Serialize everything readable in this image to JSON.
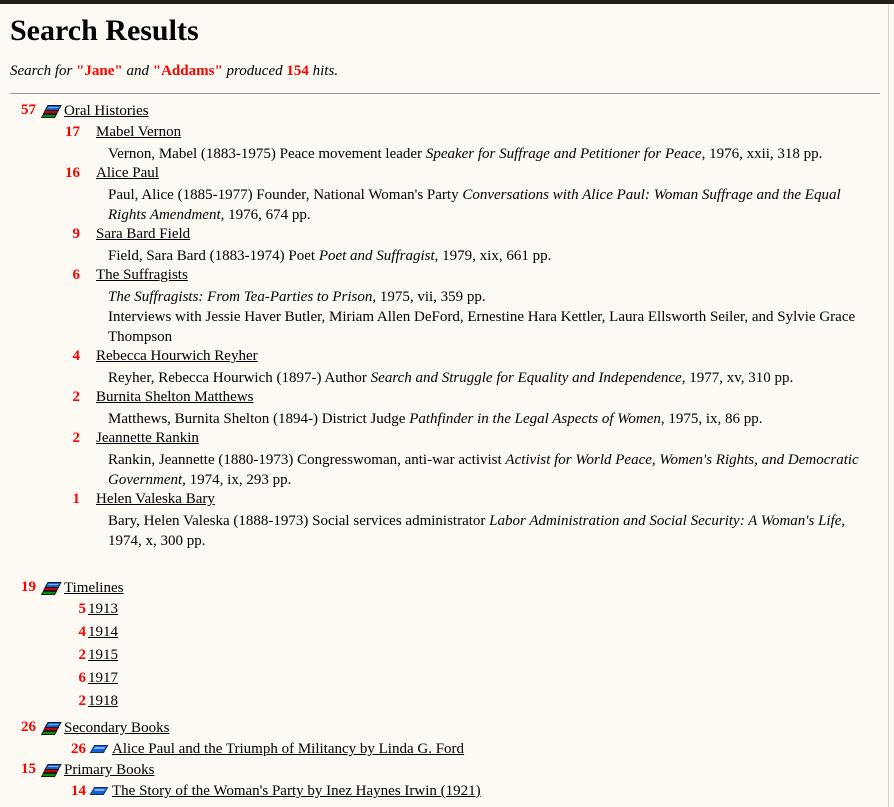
{
  "page": {
    "title": "Search Results",
    "search_prefix": "Search for ",
    "term1": "\"Jane\"",
    "conjunction": " and ",
    "term2": "\"Addams\"",
    "produced": " produced ",
    "hits": "154",
    "hits_suffix": " hits.",
    "accent_color": "#ff0000",
    "background_color": "#fdf9f3",
    "text_color": "#000000"
  },
  "groups": [
    {
      "count": "57",
      "label": "Oral Histories",
      "icon": "stacked-books-icon",
      "entries": [
        {
          "count": "17",
          "title": "Mabel Vernon",
          "desc_pre": "Vernon, Mabel (1883-1975) Peace movement leader ",
          "desc_italic": "Speaker for Suffrage and Petitioner for Peace",
          "desc_post": ", 1976, xxii, 318 pp."
        },
        {
          "count": "16",
          "title": "Alice Paul",
          "desc_pre": "Paul, Alice (1885-1977) Founder, National Woman's Party ",
          "desc_italic": "Conversations with Alice Paul: Woman Suffrage and the Equal Rights Amendment",
          "desc_post": ", 1976, 674 pp."
        },
        {
          "count": "9",
          "title": "Sara Bard Field",
          "desc_pre": "Field, Sara Bard (1883-1974) Poet ",
          "desc_italic": "Poet and Suffragist",
          "desc_post": ", 1979, xix, 661 pp."
        },
        {
          "count": "6",
          "title": "The Suffragists",
          "desc_pre": "",
          "desc_italic": "The Suffragists: From Tea-Parties to Prison",
          "desc_post": ", 1975, vii, 359 pp.",
          "desc_extra": "Interviews with Jessie Haver Butler, Miriam Allen DeFord, Ernestine Hara Kettler, Laura Ellsworth Seiler, and Sylvie Grace Thompson"
        },
        {
          "count": "4",
          "title": "Rebecca Hourwich Reyher",
          "desc_pre": "Reyher, Rebecca Hourwich (1897-) Author ",
          "desc_italic": "Search and Struggle for Equality and Independence",
          "desc_post": ", 1977, xv, 310 pp."
        },
        {
          "count": "2",
          "title": "Burnita Shelton Matthews",
          "desc_pre": "Matthews, Burnita Shelton (1894-) District Judge ",
          "desc_italic": "Pathfinder in the Legal Aspects of Women",
          "desc_post": ", 1975, ix, 86 pp."
        },
        {
          "count": "2",
          "title": "Jeannette Rankin",
          "desc_pre": "Rankin, Jeannette (1880-1973) Congresswoman, anti-war activist ",
          "desc_italic": "Activist for World Peace, Women's Rights, and Democratic Government",
          "desc_post": ", 1974, ix, 293 pp."
        },
        {
          "count": "1",
          "title": "Helen Valeska Bary",
          "desc_pre": "Bary, Helen Valeska (1888-1973) Social services administrator ",
          "desc_italic": "Labor Administration and Social Security: A Woman's Life",
          "desc_post": ", 1974, x, 300 pp."
        }
      ]
    },
    {
      "count": "19",
      "label": "Timelines",
      "icon": "stacked-books-icon",
      "years": [
        {
          "count": "5",
          "year": "1913"
        },
        {
          "count": "4",
          "year": "1914"
        },
        {
          "count": "2",
          "year": "1915"
        },
        {
          "count": "6",
          "year": "1917"
        },
        {
          "count": "2",
          "year": "1918"
        }
      ]
    },
    {
      "count": "26",
      "label": "Secondary Books",
      "icon": "stacked-books-icon",
      "books": [
        {
          "count": "26",
          "title": "Alice Paul and the Triumph of Militancy by Linda G. Ford"
        }
      ]
    },
    {
      "count": "15",
      "label": "Primary Books",
      "icon": "stacked-books-icon",
      "books": [
        {
          "count": "14",
          "title": "The Story of the Woman's Party by Inez Haynes Irwin (1921)"
        }
      ]
    }
  ]
}
